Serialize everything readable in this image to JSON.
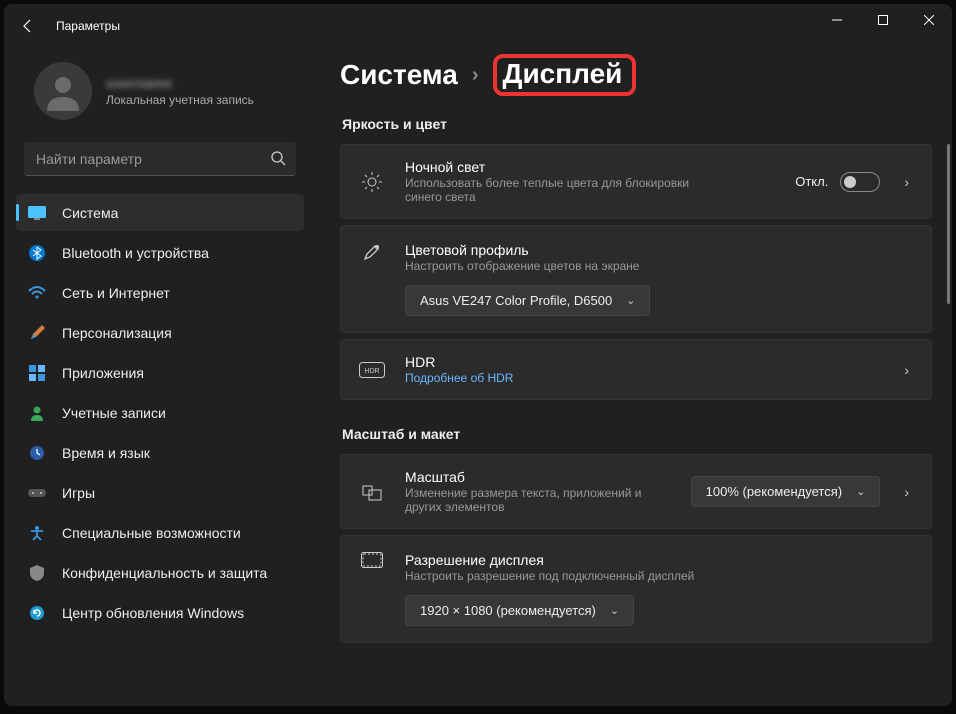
{
  "window": {
    "title": "Параметры"
  },
  "profile": {
    "name": "username",
    "type": "Локальная учетная запись"
  },
  "search": {
    "placeholder": "Найти параметр"
  },
  "nav": [
    {
      "id": "system",
      "label": "Система",
      "active": true
    },
    {
      "id": "bluetooth",
      "label": "Bluetooth и устройства"
    },
    {
      "id": "network",
      "label": "Сеть и Интернет"
    },
    {
      "id": "personalization",
      "label": "Персонализация"
    },
    {
      "id": "apps",
      "label": "Приложения"
    },
    {
      "id": "accounts",
      "label": "Учетные записи"
    },
    {
      "id": "time",
      "label": "Время и язык"
    },
    {
      "id": "gaming",
      "label": "Игры"
    },
    {
      "id": "accessibility",
      "label": "Специальные возможности"
    },
    {
      "id": "privacy",
      "label": "Конфиденциальность и защита"
    },
    {
      "id": "update",
      "label": "Центр обновления Windows"
    }
  ],
  "breadcrumb": {
    "parent": "Система",
    "current": "Дисплей"
  },
  "sections": {
    "brightness": {
      "heading": "Яркость и цвет"
    },
    "scale": {
      "heading": "Масштаб и макет"
    }
  },
  "cards": {
    "nightlight": {
      "title": "Ночной свет",
      "sub": "Использовать более теплые цвета для блокировки синего света",
      "state_label": "Откл."
    },
    "colorprofile": {
      "title": "Цветовой профиль",
      "sub": "Настроить отображение цветов на экране",
      "value": "Asus VE247 Color Profile, D6500"
    },
    "hdr": {
      "title": "HDR",
      "link": "Подробнее об HDR",
      "badge": "HDR"
    },
    "scale": {
      "title": "Масштаб",
      "sub": "Изменение размера текста, приложений и других элементов",
      "value": "100% (рекомендуется)"
    },
    "resolution": {
      "title": "Разрешение дисплея",
      "sub": "Настроить разрешение под подключенный дисплей",
      "value": "1920 × 1080 (рекомендуется)"
    }
  }
}
